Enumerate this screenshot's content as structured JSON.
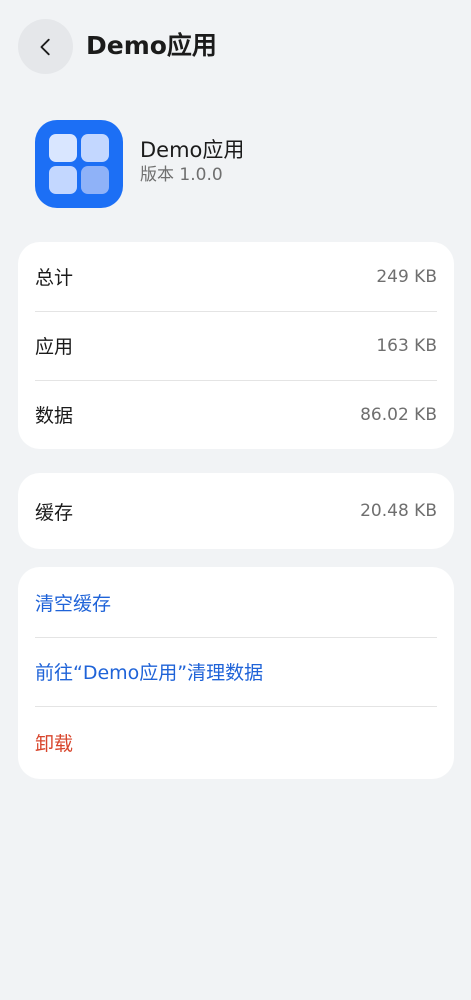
{
  "header": {
    "back_icon": "chevron-left-icon",
    "title": "Demo应用"
  },
  "app": {
    "name": "Demo应用",
    "version": "版本 1.0.0"
  },
  "storage": [
    {
      "label": "总计",
      "value": "249 KB"
    },
    {
      "label": "应用",
      "value": "163 KB"
    },
    {
      "label": "数据",
      "value": "86.02 KB"
    }
  ],
  "cache": {
    "label": "缓存",
    "value": "20.48 KB"
  },
  "actions": {
    "clear_cache": "清空缓存",
    "go_clear_data": "前往“Demo应用”清理数据",
    "uninstall": "卸载"
  },
  "colors": {
    "background": "#f1f3f5",
    "card": "#ffffff",
    "accent": "#1f63d8",
    "danger": "#d8452c",
    "app_icon": "#1c6ff5"
  }
}
